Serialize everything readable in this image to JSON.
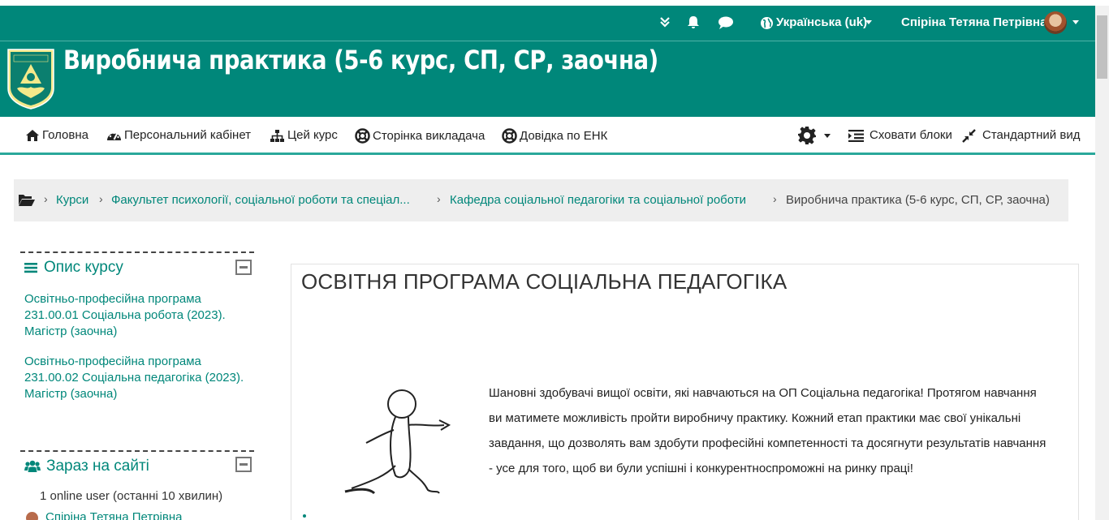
{
  "topbar": {
    "language": "Українська ‎(uk)‎",
    "user_name": "Спіріна Тетяна Петрівна",
    "icons": [
      "double-chevron-down-icon",
      "bell-icon",
      "chat-bubble-icon",
      "globe-icon"
    ]
  },
  "header": {
    "course_title": "Виробнича практика (5-6 курс, СП, СР, заочна)"
  },
  "nav": {
    "home": "Головна",
    "dashboard": "Персональний кабінет",
    "this_course": "Цей курс",
    "teacher_page": "Сторінка викладача",
    "help": "Довідка по ЕНК",
    "hide_blocks": "Сховати блоки",
    "standard_view": "Стандартний вид"
  },
  "breadcrumb": {
    "items": [
      "Курси",
      "Факультет психології, соціальної роботи та спеціал...",
      "Кафедра соціальної педагогіки та соціальної роботи",
      "Виробнича практика (5-6 курс, СП, СР, заочна)"
    ]
  },
  "blocks": {
    "description": {
      "title": "Опис курсу",
      "links": [
        "Освітньо-професійна програма 231.00.01 Соціальна робота (2023). Магістр (заочна)",
        "Освітньо-професійна програма 231.00.02 Соціальна педагогіка (2023). Магістр (заочна)"
      ]
    },
    "online": {
      "title": "Зараз на сайті",
      "count_text": "1 online user (останні 10 хвилин)",
      "user": "Спіріна Тетяна Петрівна"
    }
  },
  "main": {
    "heading": "ОСВІТНЯ ПРОГРАМА СОЦІАЛЬНА ПЕДАГОГІКА",
    "intro": "Шановні здобувачі вищої освіти, які навчаються на ОП Соціальна педагогіка! Протягом навчання ви матимете можливість  пройти  виробничу практику. Кожний  етап практики має свої унікальні завдання, що дозволять вам здобути професійні компетенності та досягнути результатів навчання - усе для того, щоб ви були успішні і конкурентноспроможні на ринку праці!"
  },
  "colors": {
    "brand": "#00877a",
    "brand_border": "#2aa89b",
    "breadcrumb_bg": "#eeeeee"
  }
}
